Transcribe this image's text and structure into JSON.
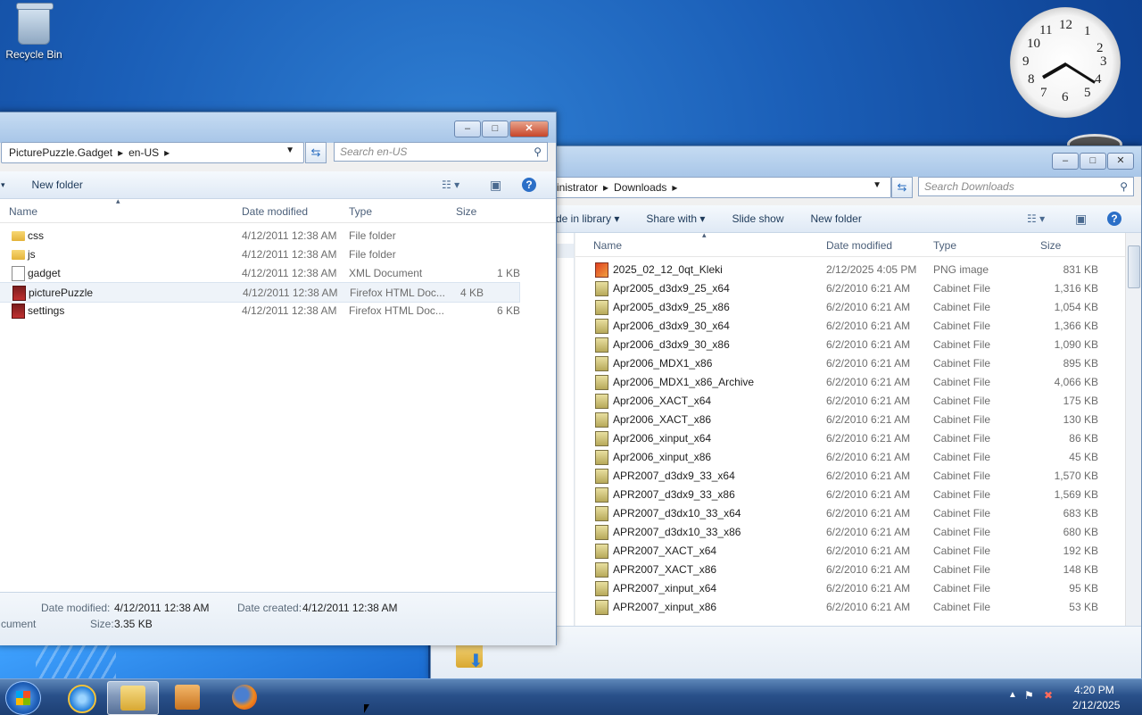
{
  "desktop": {
    "recycle_bin_label": "Recycle Bin"
  },
  "clock_gadget": {
    "numbers": [
      "12",
      "1",
      "2",
      "3",
      "4",
      "5",
      "6",
      "7",
      "8",
      "9",
      "10",
      "11"
    ]
  },
  "front_window": {
    "breadcrumb": [
      "PicturePuzzle.Gadget",
      "en-US"
    ],
    "search_placeholder": "Search en-US",
    "toolbar": {
      "new_folder": "New folder"
    },
    "columns": {
      "name": "Name",
      "date": "Date modified",
      "type": "Type",
      "size": "Size"
    },
    "files": [
      {
        "name": "css",
        "date": "4/12/2011 12:38 AM",
        "type": "File folder",
        "size": "",
        "icon": "folder"
      },
      {
        "name": "js",
        "date": "4/12/2011 12:38 AM",
        "type": "File folder",
        "size": "",
        "icon": "folder"
      },
      {
        "name": "gadget",
        "date": "4/12/2011 12:38 AM",
        "type": "XML Document",
        "size": "1 KB",
        "icon": "xml"
      },
      {
        "name": "picturePuzzle",
        "date": "4/12/2011 12:38 AM",
        "type": "Firefox HTML Doc...",
        "size": "4 KB",
        "icon": "html"
      },
      {
        "name": "settings",
        "date": "4/12/2011 12:38 AM",
        "type": "Firefox HTML Doc...",
        "size": "6 KB",
        "icon": "html"
      }
    ],
    "details": {
      "date_modified_label": "Date modified:",
      "date_modified": "4/12/2011 12:38 AM",
      "date_created_label": "Date created:",
      "date_created": "4/12/2011 12:38 AM",
      "type_partial": "cument",
      "size_label": "Size:",
      "size": "3.35 KB"
    }
  },
  "back_window": {
    "breadcrumb": [
      "inistrator",
      "Downloads"
    ],
    "search_placeholder": "Search Downloads",
    "toolbar": {
      "include": "de in library",
      "share": "Share with",
      "slideshow": "Slide show",
      "new_folder": "New folder"
    },
    "columns": {
      "name": "Name",
      "date": "Date modified",
      "type": "Type",
      "size": "Size"
    },
    "files": [
      {
        "name": "2025_02_12_0qt_Kleki",
        "date": "2/12/2025 4:05 PM",
        "type": "PNG image",
        "size": "831 KB",
        "icon": "png"
      },
      {
        "name": "Apr2005_d3dx9_25_x64",
        "date": "6/2/2010 6:21 AM",
        "type": "Cabinet File",
        "size": "1,316 KB",
        "icon": "cab"
      },
      {
        "name": "Apr2005_d3dx9_25_x86",
        "date": "6/2/2010 6:21 AM",
        "type": "Cabinet File",
        "size": "1,054 KB",
        "icon": "cab"
      },
      {
        "name": "Apr2006_d3dx9_30_x64",
        "date": "6/2/2010 6:21 AM",
        "type": "Cabinet File",
        "size": "1,366 KB",
        "icon": "cab"
      },
      {
        "name": "Apr2006_d3dx9_30_x86",
        "date": "6/2/2010 6:21 AM",
        "type": "Cabinet File",
        "size": "1,090 KB",
        "icon": "cab"
      },
      {
        "name": "Apr2006_MDX1_x86",
        "date": "6/2/2010 6:21 AM",
        "type": "Cabinet File",
        "size": "895 KB",
        "icon": "cab"
      },
      {
        "name": "Apr2006_MDX1_x86_Archive",
        "date": "6/2/2010 6:21 AM",
        "type": "Cabinet File",
        "size": "4,066 KB",
        "icon": "cab"
      },
      {
        "name": "Apr2006_XACT_x64",
        "date": "6/2/2010 6:21 AM",
        "type": "Cabinet File",
        "size": "175 KB",
        "icon": "cab"
      },
      {
        "name": "Apr2006_XACT_x86",
        "date": "6/2/2010 6:21 AM",
        "type": "Cabinet File",
        "size": "130 KB",
        "icon": "cab"
      },
      {
        "name": "Apr2006_xinput_x64",
        "date": "6/2/2010 6:21 AM",
        "type": "Cabinet File",
        "size": "86 KB",
        "icon": "cab"
      },
      {
        "name": "Apr2006_xinput_x86",
        "date": "6/2/2010 6:21 AM",
        "type": "Cabinet File",
        "size": "45 KB",
        "icon": "cab"
      },
      {
        "name": "APR2007_d3dx9_33_x64",
        "date": "6/2/2010 6:21 AM",
        "type": "Cabinet File",
        "size": "1,570 KB",
        "icon": "cab"
      },
      {
        "name": "APR2007_d3dx9_33_x86",
        "date": "6/2/2010 6:21 AM",
        "type": "Cabinet File",
        "size": "1,569 KB",
        "icon": "cab"
      },
      {
        "name": "APR2007_d3dx10_33_x64",
        "date": "6/2/2010 6:21 AM",
        "type": "Cabinet File",
        "size": "683 KB",
        "icon": "cab"
      },
      {
        "name": "APR2007_d3dx10_33_x86",
        "date": "6/2/2010 6:21 AM",
        "type": "Cabinet File",
        "size": "680 KB",
        "icon": "cab"
      },
      {
        "name": "APR2007_XACT_x64",
        "date": "6/2/2010 6:21 AM",
        "type": "Cabinet File",
        "size": "192 KB",
        "icon": "cab"
      },
      {
        "name": "APR2007_XACT_x86",
        "date": "6/2/2010 6:21 AM",
        "type": "Cabinet File",
        "size": "148 KB",
        "icon": "cab"
      },
      {
        "name": "APR2007_xinput_x64",
        "date": "6/2/2010 6:21 AM",
        "type": "Cabinet File",
        "size": "95 KB",
        "icon": "cab"
      },
      {
        "name": "APR2007_xinput_x86",
        "date": "6/2/2010 6:21 AM",
        "type": "Cabinet File",
        "size": "53 KB",
        "icon": "cab"
      }
    ]
  },
  "taskbar": {
    "time": "4:20 PM",
    "date": "2/12/2025"
  }
}
